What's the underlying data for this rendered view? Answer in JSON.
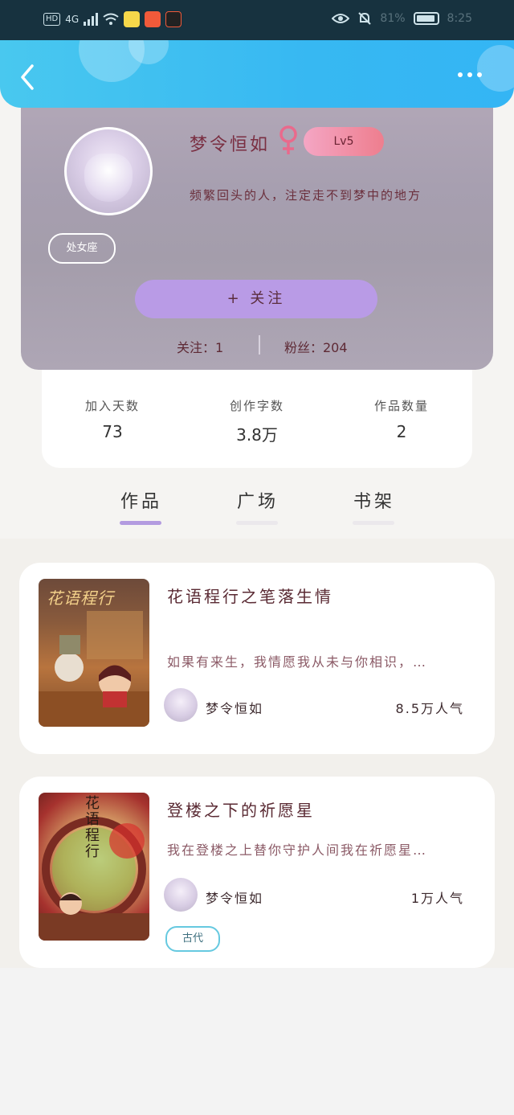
{
  "status_bar": {
    "hd": "HD",
    "network": "4G",
    "battery_text": "81%",
    "time": "8:25"
  },
  "profile": {
    "name": "梦令恒如",
    "level": "Lv5",
    "bio": "频繁回头的人，注定走不到梦中的地方",
    "zodiac": "处女座",
    "follow_button": "+  关注",
    "following": "关注：1",
    "fans": "粉丝：204"
  },
  "stats": [
    {
      "label": "加入天数",
      "value": "73"
    },
    {
      "label": "创作字数",
      "value": "3.8万"
    },
    {
      "label": "作品数量",
      "value": "2"
    }
  ],
  "tabs": [
    {
      "label": "作品",
      "active": true
    },
    {
      "label": "广场",
      "active": false
    },
    {
      "label": "书架",
      "active": false
    }
  ],
  "books": [
    {
      "title": "花语程行之笔落生情",
      "cover_text": "花语程行",
      "description": "如果有来生，我情愿我从未与你相识，…",
      "author": "梦令恒如",
      "popularity": "8.5万人气",
      "tag": ""
    },
    {
      "title": "登楼之下的祈愿星",
      "cover_text": "花语程行",
      "description": "我在登楼之上替你守护人间我在祈愿星…",
      "author": "梦令恒如",
      "popularity": "1万人气",
      "tag": "古代"
    }
  ],
  "colors": {
    "header": "#37b8f2",
    "follow_button": "#b99be6",
    "tab_active_indicator": "#b39be0",
    "tag_border": "#66c9e0"
  }
}
